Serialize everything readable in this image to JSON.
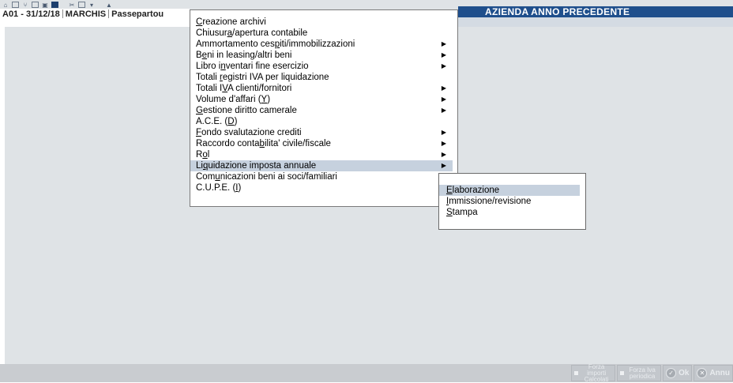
{
  "top_toolbar": {
    "icons": [
      "home-icon",
      "open-folder-icon",
      "tree-icon",
      "grid-icon",
      "image-icon",
      "monitor-icon",
      "tools-icon",
      "window-icon",
      "chevron-down-icon",
      "print-icon"
    ]
  },
  "info_bar": {
    "company": "A01 - 31/12/18",
    "user": "MARCHIS",
    "module": "Passepartou"
  },
  "header": {
    "title": "AZIENDA ANNO PRECEDENTE"
  },
  "menu": {
    "items": [
      {
        "pre": "",
        "key": "C",
        "post": "reazione archivi",
        "has_submenu": false
      },
      {
        "pre": "Chiusur",
        "key": "a",
        "post": "/apertura contabile",
        "has_submenu": false
      },
      {
        "pre": "Ammortamento ces",
        "key": "p",
        "post": "iti/immobilizzazioni",
        "has_submenu": true
      },
      {
        "pre": "B",
        "key": "e",
        "post": "ni in leasing/altri beni",
        "has_submenu": true
      },
      {
        "pre": "Libro i",
        "key": "n",
        "post": "ventari fine esercizio",
        "has_submenu": true
      },
      {
        "pre": "Totali ",
        "key": "r",
        "post": "egistri IVA per liquidazione",
        "has_submenu": false
      },
      {
        "pre": "Totali I",
        "key": "V",
        "post": "A clienti/fornitori",
        "has_submenu": true
      },
      {
        "pre": "Volume d'affari (",
        "key": "Y",
        "post": ")",
        "has_submenu": true
      },
      {
        "pre": "",
        "key": "G",
        "post": "estione diritto camerale",
        "has_submenu": true
      },
      {
        "pre": "A.C.E. (",
        "key": "D",
        "post": ")",
        "has_submenu": false
      },
      {
        "pre": "",
        "key": "F",
        "post": "ondo svalutazione crediti",
        "has_submenu": true
      },
      {
        "pre": "Raccordo conta",
        "key": "b",
        "post": "ilita' civile/fiscale",
        "has_submenu": true
      },
      {
        "pre": "R",
        "key": "o",
        "post": "l",
        "has_submenu": true
      },
      {
        "pre": "Li",
        "key": "q",
        "post": "uidazione imposta annuale",
        "has_submenu": true
      },
      {
        "pre": "Com",
        "key": "u",
        "post": "nicazioni beni ai soci/familiari",
        "has_submenu": false
      },
      {
        "pre": "C.U.P.E. (",
        "key": "I",
        "post": ")",
        "has_submenu": false
      }
    ],
    "highlighted_index": 13,
    "arrow_glyph": "▶"
  },
  "submenu": {
    "items": [
      {
        "pre": "",
        "key": "E",
        "post": "laborazione"
      },
      {
        "pre": "",
        "key": "I",
        "post": "mmissione/revisione"
      },
      {
        "pre": "",
        "key": "S",
        "post": "tampa"
      }
    ],
    "highlighted_index": 0
  },
  "bottom_bar": {
    "buttons": [
      {
        "label": "Forza importi Calcolati",
        "icon": "square-icon"
      },
      {
        "label": "Forza Iva periodica",
        "icon": "square-icon"
      },
      {
        "label": "Ok",
        "icon": "check-circle-icon"
      },
      {
        "label": "Annu",
        "icon": "cancel-circle-icon"
      }
    ]
  }
}
